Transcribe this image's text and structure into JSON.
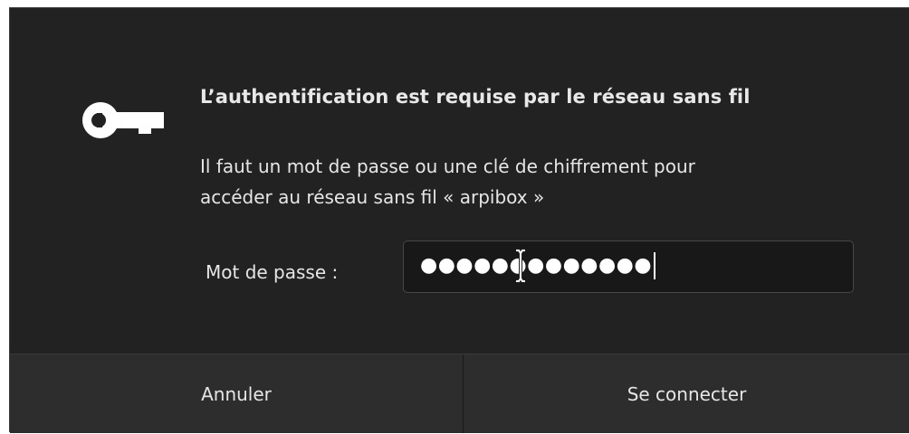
{
  "dialog": {
    "icon": "key-icon",
    "title": "L’authentification est requise par le réseau sans fil",
    "message_line1": "Il faut un mot de passe ou une clé de chiffrement pour",
    "message_line2": "accéder au réseau sans fil « arpibox »",
    "password_label": "Mot de passe :",
    "password_masked": "●●●●●●●●●●●●●",
    "cancel_label": "Annuler",
    "connect_label": "Se connecter"
  },
  "colors": {
    "dialog_bg": "#222222",
    "button_bar_bg": "#2d2d2d",
    "text": "#e6e6e6",
    "input_bg": "#181818"
  }
}
